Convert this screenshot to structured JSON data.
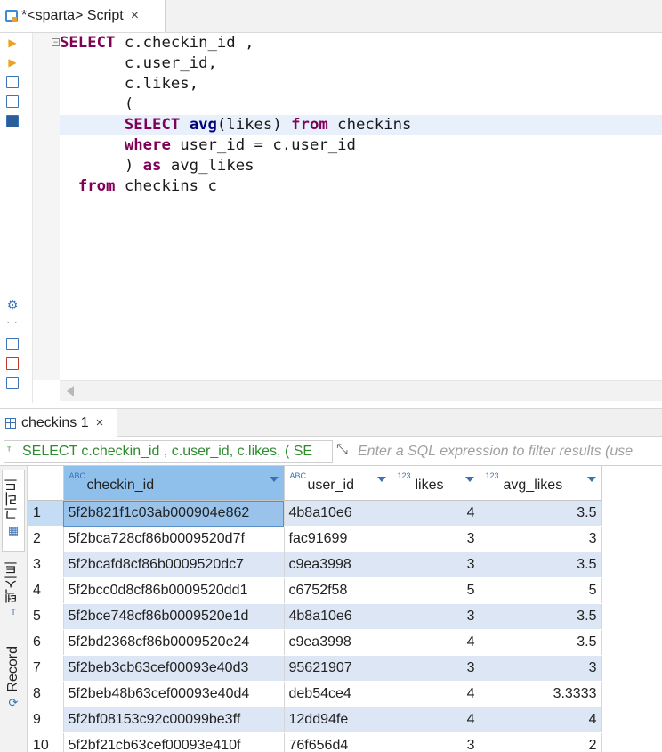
{
  "editor": {
    "tab_title": "*<sparta> Script",
    "close_glyph": "×",
    "code_lines": [
      {
        "indent": "",
        "tokens": [
          {
            "t": "SELECT",
            "c": "kw"
          },
          {
            "t": " c.checkin_id ,",
            "c": ""
          }
        ]
      },
      {
        "indent": "       ",
        "tokens": [
          {
            "t": "c.user_id,",
            "c": ""
          }
        ]
      },
      {
        "indent": "       ",
        "tokens": [
          {
            "t": "c.likes,",
            "c": ""
          }
        ]
      },
      {
        "indent": "       ",
        "tokens": [
          {
            "t": "(",
            "c": ""
          }
        ]
      },
      {
        "indent": "       ",
        "tokens": [
          {
            "t": "SELECT",
            "c": "kw"
          },
          {
            "t": " ",
            "c": ""
          },
          {
            "t": "avg",
            "c": "fn"
          },
          {
            "t": "(likes) ",
            "c": ""
          },
          {
            "t": "from",
            "c": "kw"
          },
          {
            "t": " checkins",
            "c": ""
          }
        ],
        "current": true
      },
      {
        "indent": "       ",
        "tokens": [
          {
            "t": "where",
            "c": "kw"
          },
          {
            "t": " user_id = c.user_id",
            "c": ""
          }
        ]
      },
      {
        "indent": "       ",
        "tokens": [
          {
            "t": ") ",
            "c": ""
          },
          {
            "t": "as",
            "c": "kw"
          },
          {
            "t": " avg_likes",
            "c": ""
          }
        ]
      },
      {
        "indent": "  ",
        "tokens": [
          {
            "t": "from",
            "c": "kw"
          },
          {
            "t": " checkins c",
            "c": ""
          }
        ]
      }
    ]
  },
  "results": {
    "tab_label": "checkins 1",
    "close_glyph": "×",
    "query_preview": "SELECT c.checkin_id , c.user_id, c.likes, ( SE",
    "filter_placeholder": "Enter a SQL expression to filter results (use",
    "side_tabs": [
      "그리드",
      "텍스트",
      "Record"
    ],
    "columns": [
      {
        "name": "checkin_id",
        "type": "ABC"
      },
      {
        "name": "user_id",
        "type": "ABC"
      },
      {
        "name": "likes",
        "type": "123"
      },
      {
        "name": "avg_likes",
        "type": "123"
      }
    ],
    "rows": [
      {
        "n": "1",
        "checkin_id": "5f2b821f1c03ab000904e862",
        "user_id": "4b8a10e6",
        "likes": "4",
        "avg_likes": "3.5"
      },
      {
        "n": "2",
        "checkin_id": "5f2bca728cf86b0009520d7f",
        "user_id": "fac91699",
        "likes": "3",
        "avg_likes": "3"
      },
      {
        "n": "3",
        "checkin_id": "5f2bcafd8cf86b0009520dc7",
        "user_id": "c9ea3998",
        "likes": "3",
        "avg_likes": "3.5"
      },
      {
        "n": "4",
        "checkin_id": "5f2bcc0d8cf86b0009520dd1",
        "user_id": "c6752f58",
        "likes": "5",
        "avg_likes": "5"
      },
      {
        "n": "5",
        "checkin_id": "5f2bce748cf86b0009520e1d",
        "user_id": "4b8a10e6",
        "likes": "3",
        "avg_likes": "3.5"
      },
      {
        "n": "6",
        "checkin_id": "5f2bd2368cf86b0009520e24",
        "user_id": "c9ea3998",
        "likes": "4",
        "avg_likes": "3.5"
      },
      {
        "n": "7",
        "checkin_id": "5f2beb3cb63cef00093e40d3",
        "user_id": "95621907",
        "likes": "3",
        "avg_likes": "3"
      },
      {
        "n": "8",
        "checkin_id": "5f2beb48b63cef00093e40d4",
        "user_id": "deb54ce4",
        "likes": "4",
        "avg_likes": "3.3333"
      },
      {
        "n": "9",
        "checkin_id": "5f2bf08153c92c00099be3ff",
        "user_id": "12dd94fe",
        "likes": "4",
        "avg_likes": "4"
      },
      {
        "n": "10",
        "checkin_id": "5f2bf21cb63cef00093e410f",
        "user_id": "76f656d4",
        "likes": "3",
        "avg_likes": "2"
      }
    ]
  }
}
